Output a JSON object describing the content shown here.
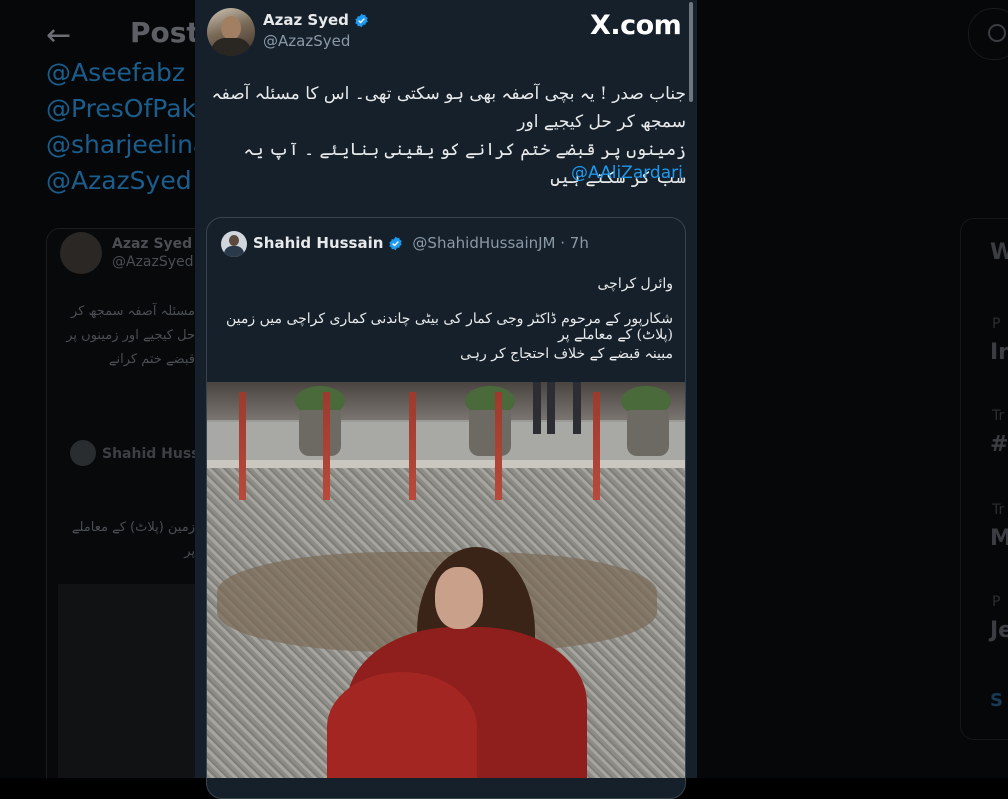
{
  "background": {
    "page_title": "Post",
    "mentions": [
      "@Aseefabz",
      "@PresOfPak",
      "@sharjeelina",
      "@AzazSyed"
    ],
    "card_author": "Azaz Syed",
    "card_handle": "@AzazSyed",
    "card_urdu": "مسئلہ آصفہ سمجھ کر حل کیجیے اور زمینوں پر قبضے ختم کرانے",
    "inner_author": "Shahid Hussain",
    "inner_urdu": "زمین (پلاٹ) کے معاملے پر",
    "trend_letters": [
      "W",
      "In",
      "#",
      "M",
      "Je",
      "S"
    ],
    "trend_small": [
      "P",
      "Tr",
      "Tr",
      "P"
    ]
  },
  "tweet": {
    "author_name": "Azaz Syed",
    "author_handle": "@AzazSyed",
    "verified": true,
    "brand_label": "X.com",
    "text_lines": [
      "جناب صدر ! یہ بچی آصفہ بھی ہو سکتی تھی۔ اس کا مسئلہ آصفہ سمجھ کر حل کیجیے اور",
      "زمینوں پر قبضے ختم کرانے کو یقینی بنایئے ۔ آپ یہ سب کر سکتے ہیں"
    ],
    "mention": "@AAliZardari"
  },
  "quote": {
    "author_name": "Shahid Hussain",
    "verified": true,
    "meta": "@ShahidHussainJM · 7h",
    "text_lines": [
      "وائرل کراچی",
      "شکارپور کے مرحوم ڈاکٹر وجی کمار کی بیٹی چاندنی کماری کراچی میں زمین (پلاٹ) کے معاملے پر",
      "مبینہ قبضے کے خلاف احتجاج کر رہی"
    ]
  },
  "colors": {
    "card_bg": "#15202b",
    "accent_blue": "#1d9bf0",
    "secondary_text": "#8b98a5",
    "border": "#38444d"
  },
  "icons": [
    "back-arrow-icon",
    "verified-badge-icon",
    "x-logo-icon",
    "search-icon"
  ]
}
